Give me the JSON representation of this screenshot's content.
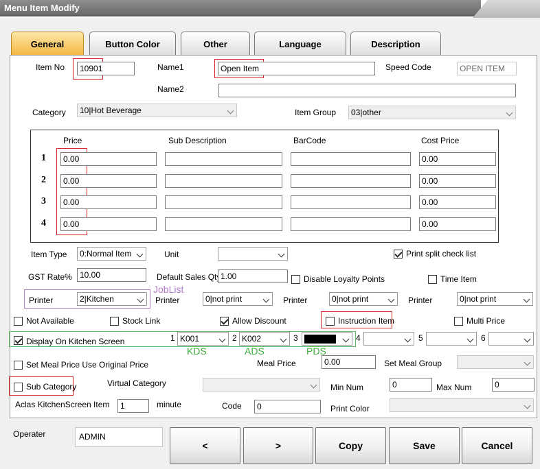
{
  "window": {
    "title": "Menu Item Modify"
  },
  "tabs": [
    "General",
    "Button Color",
    "Other",
    "Language",
    "Description"
  ],
  "form": {
    "item_no_label": "Item No",
    "item_no": "10901",
    "name1_label": "Name1",
    "name1": "Open Item",
    "speed_code_label": "Speed Code",
    "speed_code": "OPEN ITEM",
    "name2_label": "Name2",
    "name2": "",
    "category_label": "Category",
    "category": "10|Hot Beverage",
    "item_group_label": "Item Group",
    "item_group": "03|other"
  },
  "price_table": {
    "headers": [
      "Price",
      "Sub Description",
      "BarCode",
      "Cost Price"
    ],
    "rows": [
      {
        "no": "1",
        "price": "0.00",
        "sub": "",
        "barcode": "",
        "cost": "0.00"
      },
      {
        "no": "2",
        "price": "0.00",
        "sub": "",
        "barcode": "",
        "cost": "0.00"
      },
      {
        "no": "3",
        "price": "0.00",
        "sub": "",
        "barcode": "",
        "cost": "0.00"
      },
      {
        "no": "4",
        "price": "0.00",
        "sub": "",
        "barcode": "",
        "cost": "0.00"
      }
    ]
  },
  "details": {
    "item_type_label": "Item Type",
    "item_type": "0:Normal Item",
    "unit_label": "Unit",
    "unit": "",
    "print_split_label": "Print split check list",
    "gst_label": "GST Rate%",
    "gst": "10.00",
    "default_qty_label": "Default Sales Qty",
    "default_qty": "1.00",
    "disable_loyalty_label": "Disable Loyalty Points",
    "time_item_label": "Time Item",
    "joblist_note": "JobList",
    "printer_label": "Printer",
    "printer1": "2|Kitchen",
    "printer2": "0|not print",
    "printer3": "0|not print",
    "printer4": "0|not print"
  },
  "checks": {
    "not_available": "Not Available",
    "stock_link": "Stock Link",
    "allow_discount": "Allow Discount",
    "instruction_item": "Instruction Item",
    "multi_price": "Multi Price",
    "display_kitchen": "Display On Kitchen Screen"
  },
  "kitchen": {
    "n1": "1",
    "s1": "K001",
    "n2": "2",
    "s2": "K002",
    "n3": "3",
    "s3": "",
    "n4": "4",
    "s4": "",
    "n5": "5",
    "s5": "",
    "n6": "6",
    "s6": "",
    "kds_note": "KDS",
    "ads_note": "ADS",
    "pds_note": "PDS"
  },
  "meal": {
    "set_meal_label": "Set Meal Price Use Original Price",
    "meal_price_label": "Meal Price",
    "meal_price": "0.00",
    "set_meal_group_label": "Set Meal Group",
    "set_meal_group": "",
    "sub_category_label": "Sub Category",
    "virtual_category_label": "Virtual Category",
    "virtual_category": "",
    "min_num_label": "Min Num",
    "min_num": "0",
    "max_num_label": "Max Num",
    "max_num": "0",
    "aclas_label": "Aclas KitchenScreen Item",
    "aclas": "1",
    "minute_label": "minute",
    "code_label": "Code",
    "code": "0",
    "print_color_label": "Print Color",
    "print_color": ""
  },
  "footer": {
    "operator_label": "Operater",
    "operator": "ADMIN",
    "prev": "<",
    "next": ">",
    "copy": "Copy",
    "save": "Save",
    "cancel": "Cancel"
  },
  "colors": {
    "annotation_red": "#d9262b",
    "annotation_green": "#3cab3c",
    "annotation_purple": "#b07cc8",
    "active_tab": "#f3b640"
  }
}
